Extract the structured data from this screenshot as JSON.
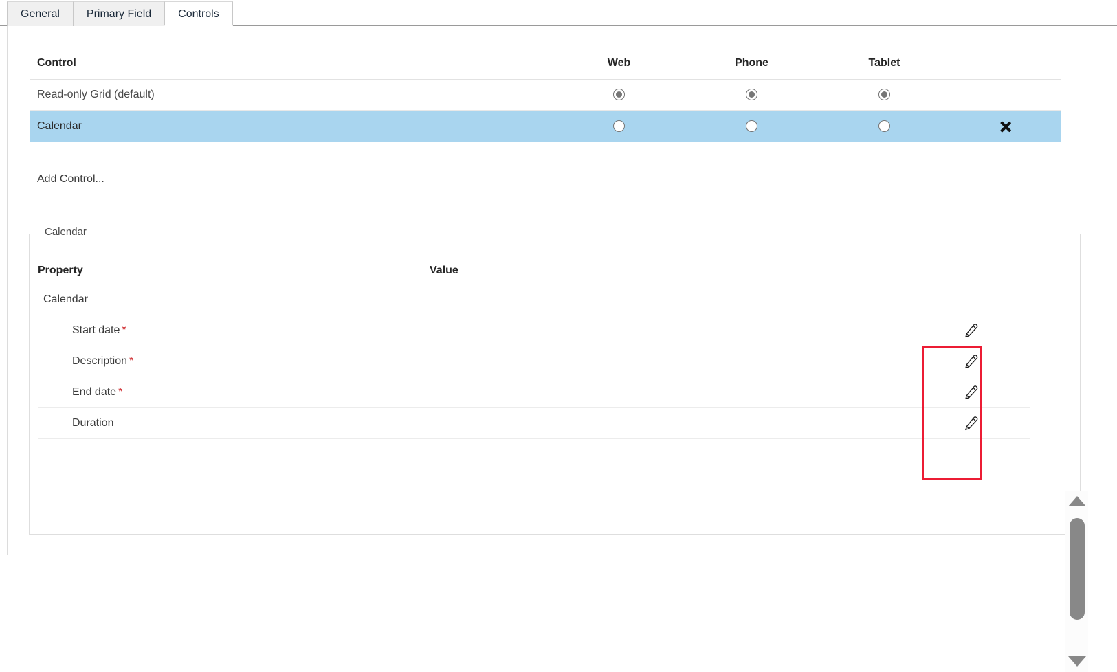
{
  "tabs": [
    {
      "label": "General",
      "active": false
    },
    {
      "label": "Primary Field",
      "active": false
    },
    {
      "label": "Controls",
      "active": true
    }
  ],
  "controls_table": {
    "headers": {
      "control": "Control",
      "web": "Web",
      "phone": "Phone",
      "tablet": "Tablet"
    },
    "rows": [
      {
        "name": "Read-only Grid (default)",
        "web": "checked",
        "phone": "checked",
        "tablet": "checked",
        "selected": false,
        "delete_icon": ""
      },
      {
        "name": "Calendar",
        "web": "unchecked",
        "phone": "unchecked",
        "tablet": "unchecked",
        "selected": true,
        "delete_icon": "close-x-icon"
      }
    ],
    "add_control_label": "Add Control..."
  },
  "fieldset": {
    "legend": "Calendar",
    "property_grid": {
      "headers": {
        "property": "Property",
        "value": "Value"
      },
      "rows": [
        {
          "property": "Calendar",
          "required": false,
          "value": "",
          "level": "group",
          "edit_icon": ""
        },
        {
          "property": "Start date",
          "required": true,
          "value": "",
          "level": "child",
          "edit_icon": "pencil-edit-icon"
        },
        {
          "property": "Description",
          "required": true,
          "value": "",
          "level": "child",
          "edit_icon": "pencil-edit-icon"
        },
        {
          "property": "End date",
          "required": true,
          "value": "",
          "level": "child",
          "edit_icon": "pencil-edit-icon"
        },
        {
          "property": "Duration",
          "required": false,
          "value": "",
          "level": "child",
          "edit_icon": "pencil-edit-icon"
        }
      ]
    }
  },
  "scrollbar": {
    "up_arrow": "scroll-up-arrow-icon",
    "down_arrow": "scroll-down-arrow-icon",
    "thumb": "scrollbar-thumb"
  },
  "annotation": {
    "highlight_color": "#ec1c34",
    "label": "edit-icons-highlight"
  },
  "colors": {
    "selected_row": "#a9d5ef",
    "required_marker": "#d13438",
    "tab_active_bg": "#ffffff",
    "tab_inactive_bg": "#f0f0f0"
  }
}
